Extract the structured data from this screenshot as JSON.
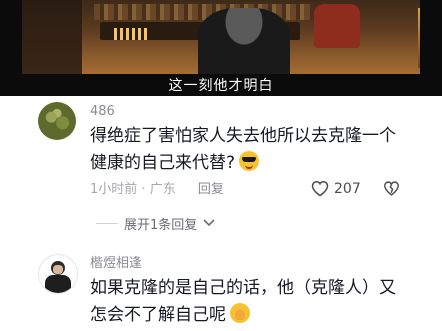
{
  "video": {
    "subtitle": "这一刻他才明白"
  },
  "comments": [
    {
      "username": "486",
      "text": "得绝症了害怕家人失去他所以去克隆一个健康的自己来代替?",
      "emoji": "cool-sunglasses-emoji",
      "time": "1小时前",
      "location": "广东",
      "reply_label": "回复",
      "likes": "207",
      "expand_label": "展开1条回复"
    },
    {
      "username": "楷煜相逢",
      "text": "如果克隆的是自己的话，他（克隆人）又怎会不了解自己呢",
      "emoji": "praying-face-emoji"
    }
  ],
  "icons": {
    "like": "heart-icon",
    "dislike": "dislike-icon",
    "expand": "chevron-down-icon"
  }
}
